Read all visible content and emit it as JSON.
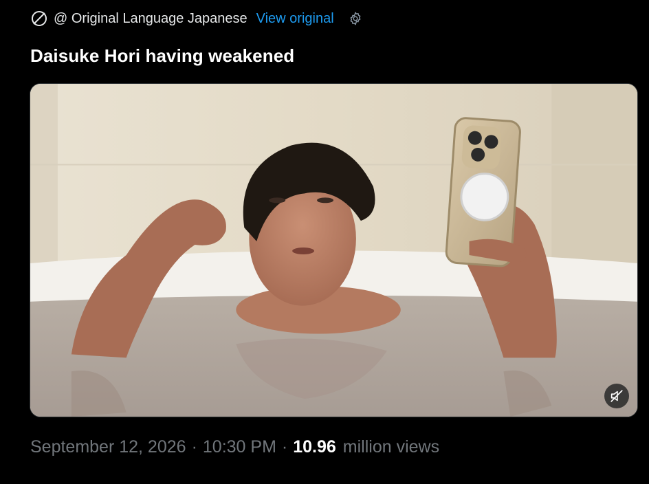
{
  "translation": {
    "prefix": "@ Original Language Japanese",
    "view_original": "View original",
    "icons": {
      "no_translate": "no-translate-icon",
      "settings": "gear-icon"
    }
  },
  "post": {
    "text": "Daisuke Hori having weakened"
  },
  "media": {
    "type": "video",
    "mute_icon": "muted-speaker-icon"
  },
  "meta": {
    "date": "September 12, 2026",
    "separator": "·",
    "time": "10:30 PM",
    "views_count": "10.96",
    "views_label": "million views"
  },
  "colors": {
    "background": "#000000",
    "link": "#1d9bf0",
    "muted_text": "#71767b",
    "text": "#e7e9ea"
  }
}
